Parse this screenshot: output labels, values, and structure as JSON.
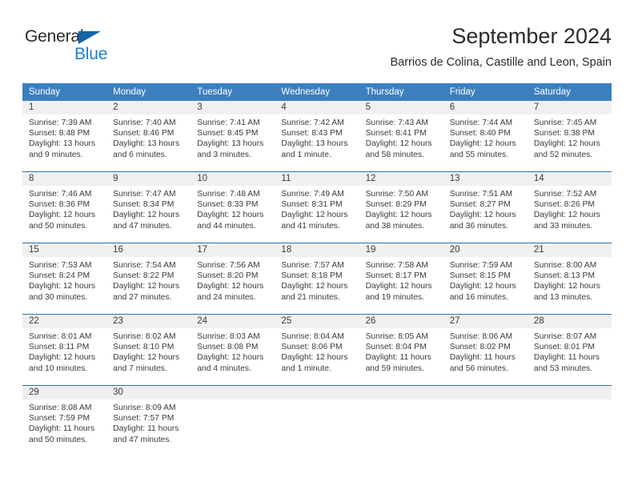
{
  "logo": {
    "word1": "General",
    "word2": "Blue",
    "accent_color": "#1d7fd0",
    "triangle_color": "#1464aa"
  },
  "header": {
    "title": "September 2024",
    "subtitle": "Barrios de Colina, Castille and Leon, Spain"
  },
  "theme": {
    "header_blue": "#3c7fbf",
    "row_divider": "#2f72ac",
    "daynum_band": "#f0f0f0",
    "text": "#3a3a3a"
  },
  "calendar": {
    "weekday_headers": [
      "Sunday",
      "Monday",
      "Tuesday",
      "Wednesday",
      "Thursday",
      "Friday",
      "Saturday"
    ],
    "weeks": [
      [
        {
          "day": "1",
          "sunrise": "Sunrise: 7:39 AM",
          "sunset": "Sunset: 8:48 PM",
          "daylight_line1": "Daylight: 13 hours",
          "daylight_line2": "and 9 minutes."
        },
        {
          "day": "2",
          "sunrise": "Sunrise: 7:40 AM",
          "sunset": "Sunset: 8:46 PM",
          "daylight_line1": "Daylight: 13 hours",
          "daylight_line2": "and 6 minutes."
        },
        {
          "day": "3",
          "sunrise": "Sunrise: 7:41 AM",
          "sunset": "Sunset: 8:45 PM",
          "daylight_line1": "Daylight: 13 hours",
          "daylight_line2": "and 3 minutes."
        },
        {
          "day": "4",
          "sunrise": "Sunrise: 7:42 AM",
          "sunset": "Sunset: 8:43 PM",
          "daylight_line1": "Daylight: 13 hours",
          "daylight_line2": "and 1 minute."
        },
        {
          "day": "5",
          "sunrise": "Sunrise: 7:43 AM",
          "sunset": "Sunset: 8:41 PM",
          "daylight_line1": "Daylight: 12 hours",
          "daylight_line2": "and 58 minutes."
        },
        {
          "day": "6",
          "sunrise": "Sunrise: 7:44 AM",
          "sunset": "Sunset: 8:40 PM",
          "daylight_line1": "Daylight: 12 hours",
          "daylight_line2": "and 55 minutes."
        },
        {
          "day": "7",
          "sunrise": "Sunrise: 7:45 AM",
          "sunset": "Sunset: 8:38 PM",
          "daylight_line1": "Daylight: 12 hours",
          "daylight_line2": "and 52 minutes."
        }
      ],
      [
        {
          "day": "8",
          "sunrise": "Sunrise: 7:46 AM",
          "sunset": "Sunset: 8:36 PM",
          "daylight_line1": "Daylight: 12 hours",
          "daylight_line2": "and 50 minutes."
        },
        {
          "day": "9",
          "sunrise": "Sunrise: 7:47 AM",
          "sunset": "Sunset: 8:34 PM",
          "daylight_line1": "Daylight: 12 hours",
          "daylight_line2": "and 47 minutes."
        },
        {
          "day": "10",
          "sunrise": "Sunrise: 7:48 AM",
          "sunset": "Sunset: 8:33 PM",
          "daylight_line1": "Daylight: 12 hours",
          "daylight_line2": "and 44 minutes."
        },
        {
          "day": "11",
          "sunrise": "Sunrise: 7:49 AM",
          "sunset": "Sunset: 8:31 PM",
          "daylight_line1": "Daylight: 12 hours",
          "daylight_line2": "and 41 minutes."
        },
        {
          "day": "12",
          "sunrise": "Sunrise: 7:50 AM",
          "sunset": "Sunset: 8:29 PM",
          "daylight_line1": "Daylight: 12 hours",
          "daylight_line2": "and 38 minutes."
        },
        {
          "day": "13",
          "sunrise": "Sunrise: 7:51 AM",
          "sunset": "Sunset: 8:27 PM",
          "daylight_line1": "Daylight: 12 hours",
          "daylight_line2": "and 36 minutes."
        },
        {
          "day": "14",
          "sunrise": "Sunrise: 7:52 AM",
          "sunset": "Sunset: 8:26 PM",
          "daylight_line1": "Daylight: 12 hours",
          "daylight_line2": "and 33 minutes."
        }
      ],
      [
        {
          "day": "15",
          "sunrise": "Sunrise: 7:53 AM",
          "sunset": "Sunset: 8:24 PM",
          "daylight_line1": "Daylight: 12 hours",
          "daylight_line2": "and 30 minutes."
        },
        {
          "day": "16",
          "sunrise": "Sunrise: 7:54 AM",
          "sunset": "Sunset: 8:22 PM",
          "daylight_line1": "Daylight: 12 hours",
          "daylight_line2": "and 27 minutes."
        },
        {
          "day": "17",
          "sunrise": "Sunrise: 7:56 AM",
          "sunset": "Sunset: 8:20 PM",
          "daylight_line1": "Daylight: 12 hours",
          "daylight_line2": "and 24 minutes."
        },
        {
          "day": "18",
          "sunrise": "Sunrise: 7:57 AM",
          "sunset": "Sunset: 8:18 PM",
          "daylight_line1": "Daylight: 12 hours",
          "daylight_line2": "and 21 minutes."
        },
        {
          "day": "19",
          "sunrise": "Sunrise: 7:58 AM",
          "sunset": "Sunset: 8:17 PM",
          "daylight_line1": "Daylight: 12 hours",
          "daylight_line2": "and 19 minutes."
        },
        {
          "day": "20",
          "sunrise": "Sunrise: 7:59 AM",
          "sunset": "Sunset: 8:15 PM",
          "daylight_line1": "Daylight: 12 hours",
          "daylight_line2": "and 16 minutes."
        },
        {
          "day": "21",
          "sunrise": "Sunrise: 8:00 AM",
          "sunset": "Sunset: 8:13 PM",
          "daylight_line1": "Daylight: 12 hours",
          "daylight_line2": "and 13 minutes."
        }
      ],
      [
        {
          "day": "22",
          "sunrise": "Sunrise: 8:01 AM",
          "sunset": "Sunset: 8:11 PM",
          "daylight_line1": "Daylight: 12 hours",
          "daylight_line2": "and 10 minutes."
        },
        {
          "day": "23",
          "sunrise": "Sunrise: 8:02 AM",
          "sunset": "Sunset: 8:10 PM",
          "daylight_line1": "Daylight: 12 hours",
          "daylight_line2": "and 7 minutes."
        },
        {
          "day": "24",
          "sunrise": "Sunrise: 8:03 AM",
          "sunset": "Sunset: 8:08 PM",
          "daylight_line1": "Daylight: 12 hours",
          "daylight_line2": "and 4 minutes."
        },
        {
          "day": "25",
          "sunrise": "Sunrise: 8:04 AM",
          "sunset": "Sunset: 8:06 PM",
          "daylight_line1": "Daylight: 12 hours",
          "daylight_line2": "and 1 minute."
        },
        {
          "day": "26",
          "sunrise": "Sunrise: 8:05 AM",
          "sunset": "Sunset: 8:04 PM",
          "daylight_line1": "Daylight: 11 hours",
          "daylight_line2": "and 59 minutes."
        },
        {
          "day": "27",
          "sunrise": "Sunrise: 8:06 AM",
          "sunset": "Sunset: 8:02 PM",
          "daylight_line1": "Daylight: 11 hours",
          "daylight_line2": "and 56 minutes."
        },
        {
          "day": "28",
          "sunrise": "Sunrise: 8:07 AM",
          "sunset": "Sunset: 8:01 PM",
          "daylight_line1": "Daylight: 11 hours",
          "daylight_line2": "and 53 minutes."
        }
      ],
      [
        {
          "day": "29",
          "sunrise": "Sunrise: 8:08 AM",
          "sunset": "Sunset: 7:59 PM",
          "daylight_line1": "Daylight: 11 hours",
          "daylight_line2": "and 50 minutes."
        },
        {
          "day": "30",
          "sunrise": "Sunrise: 8:09 AM",
          "sunset": "Sunset: 7:57 PM",
          "daylight_line1": "Daylight: 11 hours",
          "daylight_line2": "and 47 minutes."
        },
        {
          "day": "",
          "sunrise": "",
          "sunset": "",
          "daylight_line1": "",
          "daylight_line2": ""
        },
        {
          "day": "",
          "sunrise": "",
          "sunset": "",
          "daylight_line1": "",
          "daylight_line2": ""
        },
        {
          "day": "",
          "sunrise": "",
          "sunset": "",
          "daylight_line1": "",
          "daylight_line2": ""
        },
        {
          "day": "",
          "sunrise": "",
          "sunset": "",
          "daylight_line1": "",
          "daylight_line2": ""
        },
        {
          "day": "",
          "sunrise": "",
          "sunset": "",
          "daylight_line1": "",
          "daylight_line2": ""
        }
      ]
    ]
  }
}
